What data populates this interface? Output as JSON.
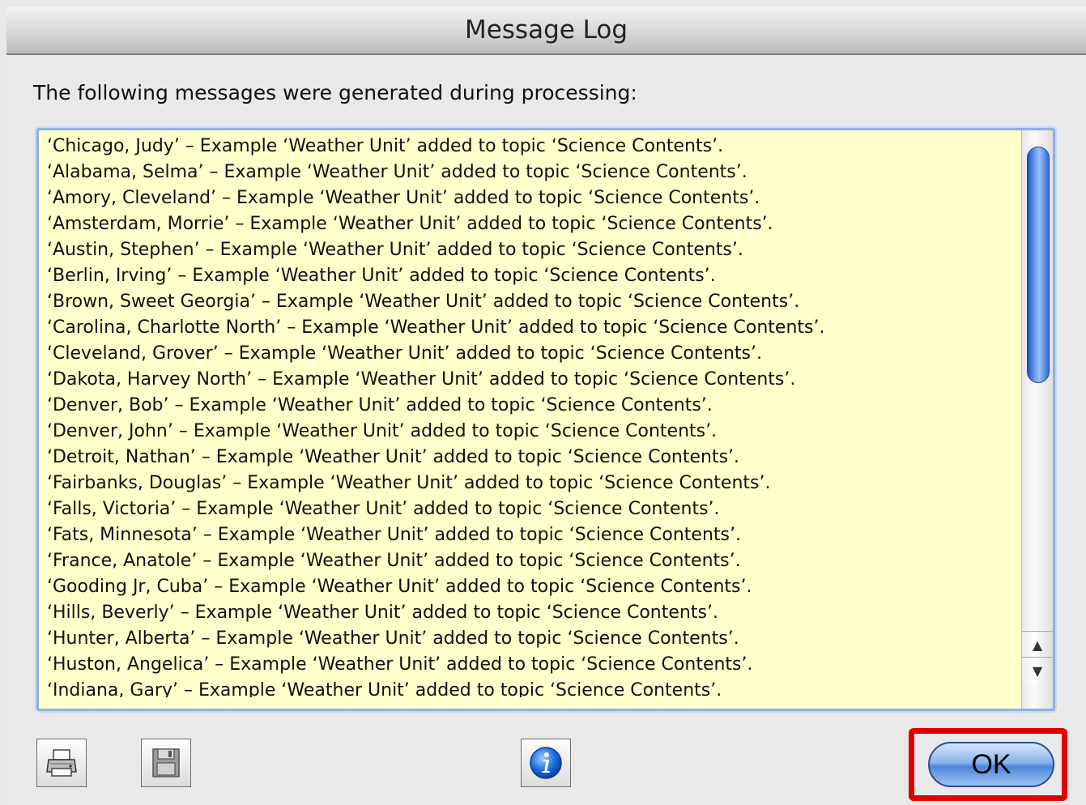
{
  "window": {
    "title": "Message Log"
  },
  "prompt": "The following messages were generated during processing:",
  "log": [
    "‘Chicago, Judy’ – Example ‘Weather Unit’ added to topic ‘Science Contents’.",
    "‘Alabama, Selma’ – Example ‘Weather Unit’ added to topic ‘Science Contents’.",
    "‘Amory, Cleveland’ – Example ‘Weather Unit’ added to topic ‘Science Contents’.",
    "‘Amsterdam, Morrie’ – Example ‘Weather Unit’ added to topic ‘Science Contents’.",
    "‘Austin, Stephen’ – Example ‘Weather Unit’ added to topic ‘Science Contents’.",
    "‘Berlin, Irving’ – Example ‘Weather Unit’ added to topic ‘Science Contents’.",
    "‘Brown, Sweet Georgia’ – Example ‘Weather Unit’ added to topic ‘Science Contents’.",
    "‘Carolina, Charlotte North’ – Example ‘Weather Unit’ added to topic ‘Science Contents’.",
    "‘Cleveland, Grover’ – Example ‘Weather Unit’ added to topic ‘Science Contents’.",
    "‘Dakota, Harvey North’ – Example ‘Weather Unit’ added to topic ‘Science Contents’.",
    "‘Denver, Bob’ – Example ‘Weather Unit’ added to topic ‘Science Contents’.",
    "‘Denver, John’ – Example ‘Weather Unit’ added to topic ‘Science Contents’.",
    "‘Detroit, Nathan’ – Example ‘Weather Unit’ added to topic ‘Science Contents’.",
    "‘Fairbanks, Douglas’ – Example ‘Weather Unit’ added to topic ‘Science Contents’.",
    "‘Falls, Victoria’ – Example ‘Weather Unit’ added to topic ‘Science Contents’.",
    "‘Fats, Minnesota’ – Example ‘Weather Unit’ added to topic ‘Science Contents’.",
    "‘France, Anatole’ – Example ‘Weather Unit’ added to topic ‘Science Contents’.",
    "‘Gooding Jr, Cuba’ – Example ‘Weather Unit’ added to topic ‘Science Contents’.",
    "‘Hills, Beverly’ – Example ‘Weather Unit’ added to topic ‘Science Contents’.",
    "‘Hunter, Alberta’ – Example ‘Weather Unit’ added to topic ‘Science Contents’.",
    "‘Huston, Angelica’ – Example ‘Weather Unit’ added to topic ‘Science Contents’.",
    "‘Indiana, Gary’ – Example ‘Weather Unit’ added to topic ‘Science Contents’."
  ],
  "scrollbar": {
    "position_fraction": 0.0
  },
  "buttons": {
    "ok_label": "OK",
    "print_icon": "printer-icon",
    "save_icon": "floppy-disk-icon",
    "info_icon": "info-icon"
  },
  "colors": {
    "log_background": "#ffffcc",
    "ok_highlight": "#e00000",
    "accent_blue": "#4f86d8"
  }
}
